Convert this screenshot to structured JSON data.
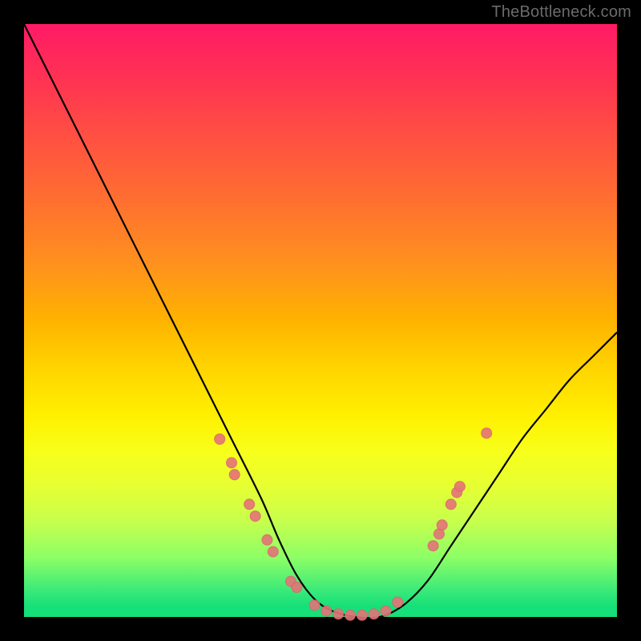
{
  "watermark": "TheBottleneck.com",
  "chart_data": {
    "type": "line",
    "title": "",
    "xlabel": "",
    "ylabel": "",
    "xlim": [
      0,
      100
    ],
    "ylim": [
      0,
      100
    ],
    "grid": false,
    "legend": false,
    "series": [
      {
        "name": "bottleneck-curve",
        "x": [
          0,
          5,
          10,
          15,
          20,
          25,
          30,
          35,
          40,
          43,
          46,
          49,
          52,
          56,
          60,
          64,
          68,
          72,
          76,
          80,
          84,
          88,
          92,
          96,
          100
        ],
        "y": [
          100,
          90,
          80,
          70,
          60,
          50,
          40,
          30,
          20,
          13,
          7,
          3,
          1,
          0,
          0,
          2,
          6,
          12,
          18,
          24,
          30,
          35,
          40,
          44,
          48
        ]
      }
    ],
    "markers": {
      "name": "highlighted-points",
      "points": [
        {
          "x": 33,
          "y": 30
        },
        {
          "x": 35,
          "y": 26
        },
        {
          "x": 35.5,
          "y": 24
        },
        {
          "x": 38,
          "y": 19
        },
        {
          "x": 39,
          "y": 17
        },
        {
          "x": 41,
          "y": 13
        },
        {
          "x": 42,
          "y": 11
        },
        {
          "x": 45,
          "y": 6
        },
        {
          "x": 46,
          "y": 5
        },
        {
          "x": 49,
          "y": 2
        },
        {
          "x": 51,
          "y": 1
        },
        {
          "x": 53,
          "y": 0.5
        },
        {
          "x": 55,
          "y": 0.3
        },
        {
          "x": 57,
          "y": 0.3
        },
        {
          "x": 59,
          "y": 0.5
        },
        {
          "x": 61,
          "y": 1
        },
        {
          "x": 63,
          "y": 2.5
        },
        {
          "x": 69,
          "y": 12
        },
        {
          "x": 70,
          "y": 14
        },
        {
          "x": 70.5,
          "y": 15.5
        },
        {
          "x": 72,
          "y": 19
        },
        {
          "x": 73,
          "y": 21
        },
        {
          "x": 73.5,
          "y": 22
        },
        {
          "x": 78,
          "y": 31
        }
      ]
    }
  }
}
